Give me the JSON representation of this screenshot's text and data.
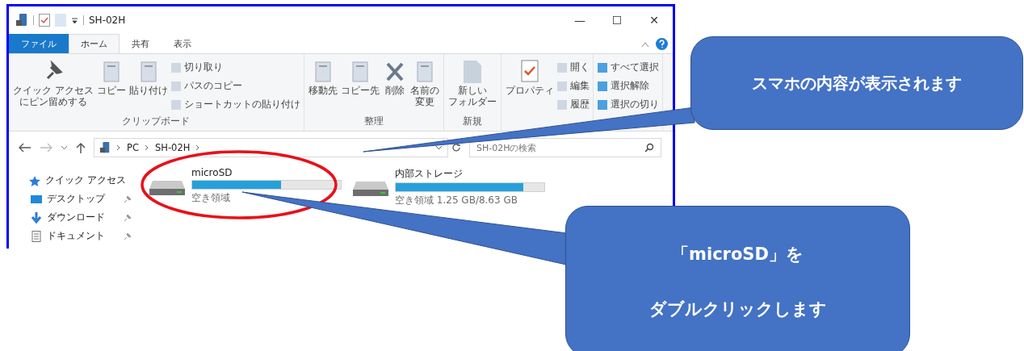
{
  "window": {
    "title": "SH-02H",
    "controls": [
      "—",
      "☐",
      "✕"
    ]
  },
  "tabs": [
    {
      "label": "ファイル",
      "kind": "file",
      "selected": false
    },
    {
      "label": "ホーム",
      "kind": "tab",
      "selected": true
    },
    {
      "label": "共有",
      "kind": "tab",
      "selected": false
    },
    {
      "label": "表示",
      "kind": "tab",
      "selected": false
    }
  ],
  "ribbon": [
    {
      "label": "クリップボード",
      "big": [
        {
          "lines": [
            "クイック アクセス",
            "にピン留めする"
          ]
        },
        {
          "lines": [
            "コピー"
          ]
        },
        {
          "lines": [
            "貼り付け"
          ]
        }
      ],
      "small": [
        "切り取り",
        "パスのコピー",
        "ショートカットの貼り付け"
      ]
    },
    {
      "label": "整理",
      "big": [
        {
          "lines": [
            "移動先"
          ]
        },
        {
          "lines": [
            "コピー先"
          ]
        },
        {
          "lines": [
            "削除"
          ]
        },
        {
          "lines": [
            "名前の",
            "変更"
          ]
        }
      ]
    },
    {
      "label": "新規",
      "big": [
        {
          "lines": [
            "新しい",
            "フォルダー"
          ]
        }
      ]
    },
    {
      "big": [
        {
          "lines": [
            "プロパティ"
          ]
        }
      ],
      "small": [
        "開く",
        "編集",
        "履歴"
      ]
    },
    {
      "small": [
        "すべて選択",
        "選択解除",
        "選択の切り"
      ]
    }
  ],
  "address": {
    "path": [
      "PC",
      "SH-02H"
    ],
    "search": {
      "placeholder": "SH-02Hの検索"
    }
  },
  "sidebar": {
    "items": [
      {
        "label": "クイック アクセス",
        "pinned": false
      },
      {
        "label": "デスクトップ",
        "pinned": true
      },
      {
        "label": "ダウンロード",
        "pinned": true
      },
      {
        "label": "ドキュメント",
        "pinned": true
      }
    ]
  },
  "drives": [
    {
      "name": "microSD",
      "level": 0.6,
      "free": "空き領域",
      "selected": true
    },
    {
      "name": "内部ストレージ",
      "level": 0.86,
      "free": "空き領域 1.25 GB/8.63 GB",
      "selected": false
    }
  ],
  "callouts": [
    {
      "lines": [
        "スマホの内容が表示されます"
      ]
    },
    {
      "lines": [
        "「microSD」を",
        "ダブルクリックします"
      ]
    }
  ]
}
